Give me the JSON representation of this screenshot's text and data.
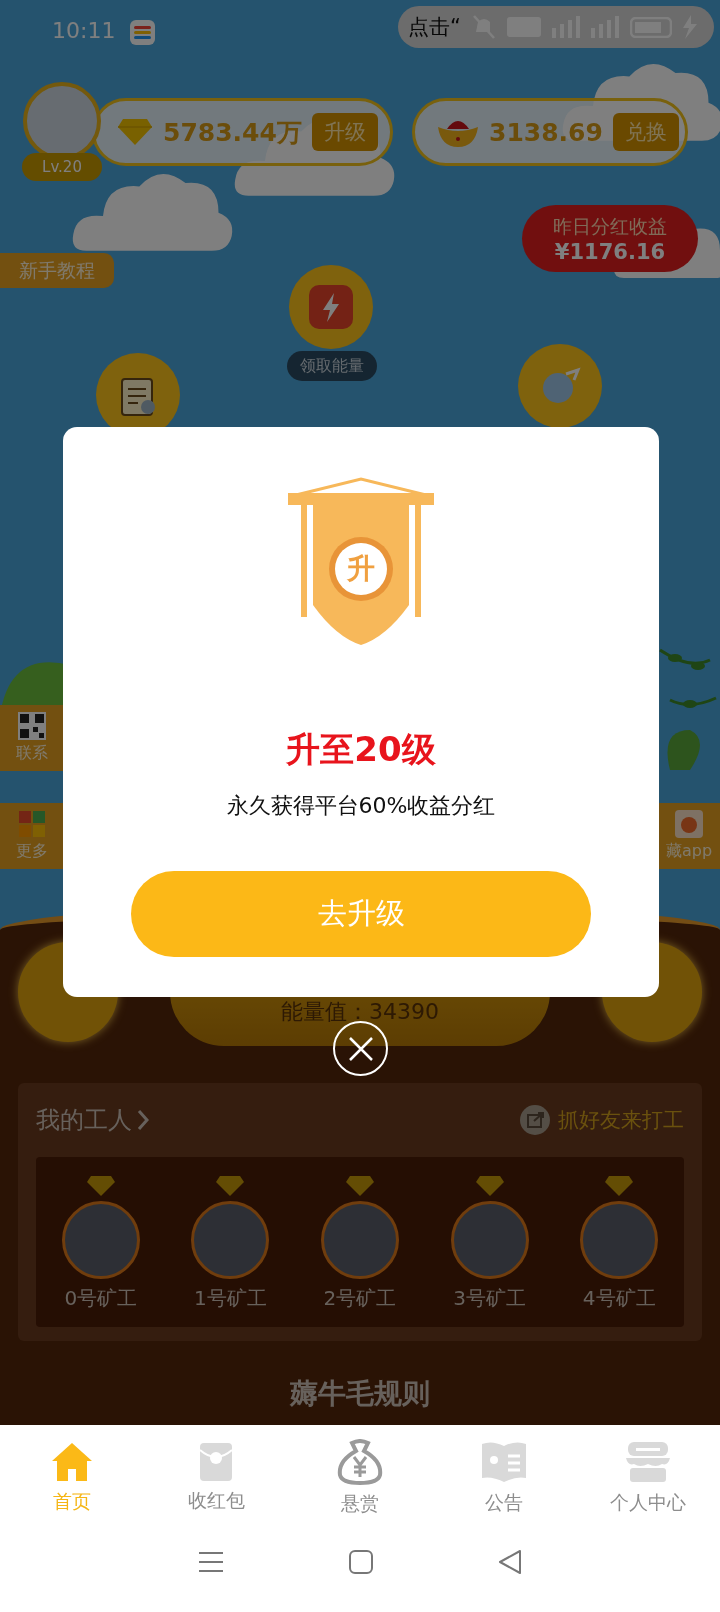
{
  "status_bar": {
    "time": "10:11",
    "toast": "点击“"
  },
  "profile": {
    "level": "Lv.20"
  },
  "balances": [
    {
      "kind": "diamond",
      "amount": "5783.44万",
      "action": "升级"
    },
    {
      "kind": "ingot",
      "amount": "3138.69",
      "action": "兑换"
    }
  ],
  "dividend": {
    "label": "昨日分红收益",
    "amount": "¥1176.16"
  },
  "tutorial": "新手教程",
  "energy_button": "领取能量",
  "left_links": [
    {
      "kind": "qr",
      "label": "联系"
    },
    {
      "kind": "grid",
      "label": "更多"
    }
  ],
  "right_links": [
    {
      "kind": "app",
      "label": "藏app"
    }
  ],
  "energy": {
    "value": "能量值：34390"
  },
  "workers": {
    "title": "我的工人",
    "invite": "抓好友来打工",
    "items": [
      {
        "name": "0号矿工"
      },
      {
        "name": "1号矿工"
      },
      {
        "name": "2号矿工"
      },
      {
        "name": "3号矿工"
      },
      {
        "name": "4号矿工"
      }
    ]
  },
  "rules_title": "薅牛毛规则",
  "dialog": {
    "badge": "升",
    "title": "升至20级",
    "message": "永久获得平台60%收益分红",
    "action": "去升级"
  },
  "tabs": [
    {
      "label": "首页",
      "selected": true
    },
    {
      "label": "收红包",
      "selected": false
    },
    {
      "label": "悬赏",
      "selected": false
    },
    {
      "label": "公告",
      "selected": false
    },
    {
      "label": "个人中心",
      "selected": false
    }
  ]
}
